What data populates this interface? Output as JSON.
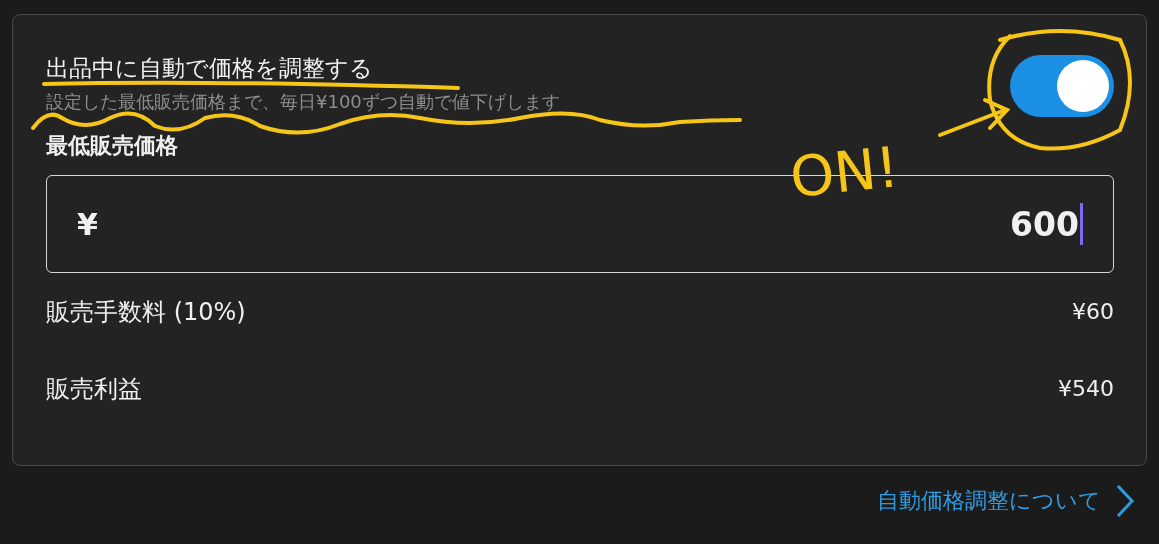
{
  "setting": {
    "title": "出品中に自動で価格を調整する",
    "description": "設定した最低販売価格まで、毎日¥100ずつ自動で値下げします",
    "on": true
  },
  "min_price": {
    "label": "最低販売価格",
    "currency": "¥",
    "value": "600"
  },
  "rows": [
    {
      "label": "販売手数料 (10%)",
      "value": "¥60"
    },
    {
      "label": "販売利益",
      "value": "¥540"
    }
  ],
  "link": {
    "label": "自動価格調整について"
  },
  "annotation": {
    "text": "ON!"
  }
}
